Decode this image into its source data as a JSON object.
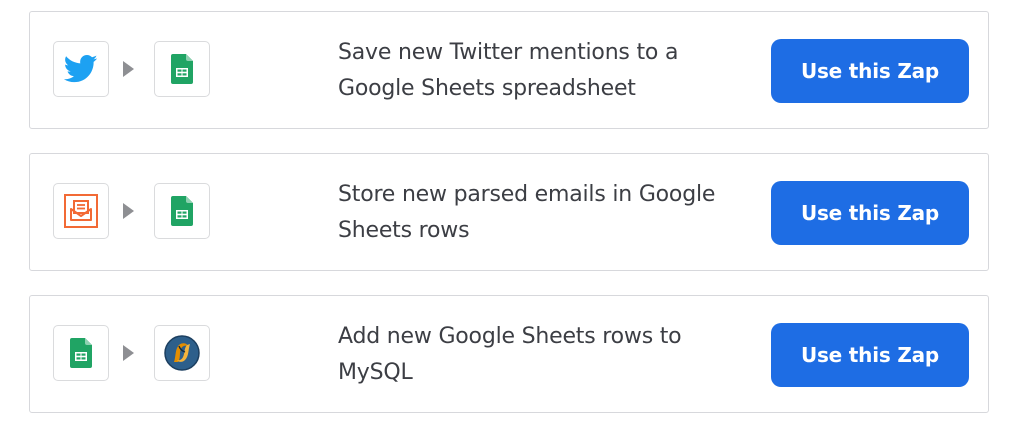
{
  "zaps": [
    {
      "trigger_app_icon": "twitter-icon",
      "action_app_icon": "google-sheets-icon",
      "description": "Save new Twitter mentions to a Google Sheets spreadsheet",
      "button_label": "Use this Zap"
    },
    {
      "trigger_app_icon": "email-parser-icon",
      "action_app_icon": "google-sheets-icon",
      "description": "Store new parsed emails in Google Sheets rows",
      "button_label": "Use this Zap"
    },
    {
      "trigger_app_icon": "google-sheets-icon",
      "action_app_icon": "mysql-icon",
      "description": "Add new Google Sheets rows to MySQL",
      "button_label": "Use this Zap"
    }
  ],
  "colors": {
    "button": "#1e6de4",
    "twitter": "#1da1f2",
    "sheets": "#20a464",
    "email_parser": "#f26a35",
    "mysql_blue": "#2d5f8b",
    "mysql_orange": "#e48e00"
  }
}
